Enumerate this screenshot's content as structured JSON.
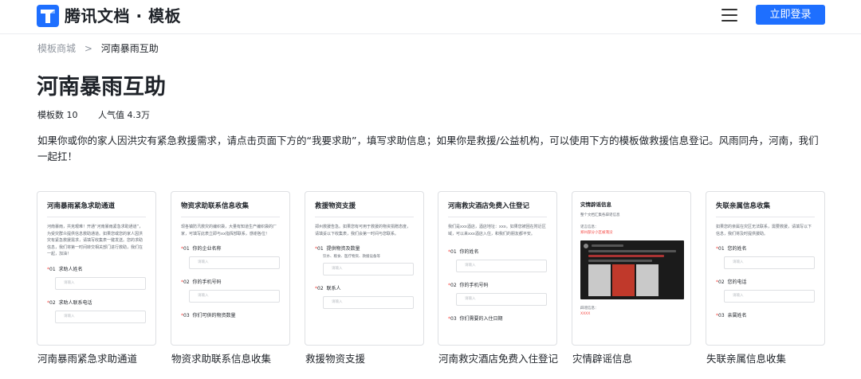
{
  "header": {
    "brand": "腾讯文档 · 模板",
    "login_label": "立即登录"
  },
  "breadcrumb": {
    "root": "模板商城",
    "separator": ">",
    "current": "河南暴雨互助"
  },
  "page": {
    "title": "河南暴雨互助",
    "template_count": "模板数 10",
    "popularity": "人气值 4.3万",
    "description": "如果你或你的家人因洪灾有紧急救援需求，请点击页面下方的“我要求助”，填写求助信息；如果你是救援/公益机构，可以使用下方的模板做救援信息登记。风雨同舟，河南，我们一起扛！"
  },
  "colors": {
    "accent": "#1e6fff",
    "required_star": "#f54a45"
  },
  "cards": [
    {
      "label": "河南暴雨紧急求助通道",
      "preview_title": "河南暴雨紧急求助通道",
      "preview_text": "河南暴雨，共克艰难！开通“河南暴雨紧急求助通道”，为受灾群众提供信息救助通道。如果您或您的家人因洪灾有紧急救援需求，请填写收集表一键发送。您的求助信息，我们将第一时间转交相关部门进行救助，我们在一起，加油！",
      "fields": [
        {
          "no": "01",
          "name": "求助人姓名",
          "placeholder": "请输入"
        },
        {
          "no": "02",
          "name": "求助人联系电话",
          "placeholder": "请输入"
        }
      ]
    },
    {
      "label": "物资求助联系信息收集",
      "preview_title": "物资求助联系信息收集",
      "preview_text": "现各镇防汛救灾的编织袋，大量有知道生产编织袋的厂家，可填写此表立即与xx指挥部联系，感谢各位！",
      "fields": [
        {
          "no": "01",
          "name": "你的企业名称",
          "placeholder": "请输入"
        },
        {
          "no": "02",
          "name": "你的手机号码",
          "placeholder": "请输入"
        },
        {
          "no": "03",
          "name": "你们可供的物资数量",
          "placeholder": ""
        }
      ]
    },
    {
      "label": "救援物资支援",
      "preview_title": "救援物资支援",
      "preview_text": "郑州救援告急。如果您有可用于救援的物资捐赠态度，请填妥以下收集表，我们会第一时间与您联系。",
      "fields": [
        {
          "no": "01",
          "name": "提供物资及数量",
          "hint": "饮水、粮食、医疗物资、救援设备等",
          "placeholder": "请输入"
        },
        {
          "no": "02",
          "name": "联系人",
          "placeholder": "请输入"
        }
      ]
    },
    {
      "label": "河南救灾酒店免费入住登记",
      "preview_title": "河南救灾酒店免费入住登记",
      "preview_text": "我们是xxx酒店，酒店地址：xxx。如果您被困在附近区域，可以来xxx酒店入住，和我们的朋友都平安。",
      "fields": [
        {
          "no": "01",
          "name": "你的姓名",
          "placeholder": "请输入"
        },
        {
          "no": "02",
          "name": "你的手机号码",
          "placeholder": "请输入"
        },
        {
          "no": "03",
          "name": "你们需要的入住日期",
          "placeholder": ""
        }
      ]
    },
    {
      "label": "灾情辟谣信息",
      "preview_title": "灾情辟谣信息",
      "preview_text": "整个文档汇集各辟谣信息",
      "rumor_heading": "谣言信息：",
      "rumor_text": "郑州部分小区被淹没",
      "verify_heading": "辟谣信息：",
      "verify_text": "XXXX"
    },
    {
      "label": "失联亲属信息收集",
      "preview_title": "失联亲属信息收集",
      "preview_text": "如果您的亲属在灾区无法联系，需要救援，请填写以下信息，我们将及时提供援助。",
      "fields": [
        {
          "no": "01",
          "name": "您的姓名",
          "placeholder": "请输入"
        },
        {
          "no": "02",
          "name": "您的电话",
          "placeholder": "请输入"
        },
        {
          "no": "03",
          "name": "亲属姓名",
          "placeholder": ""
        }
      ]
    }
  ]
}
